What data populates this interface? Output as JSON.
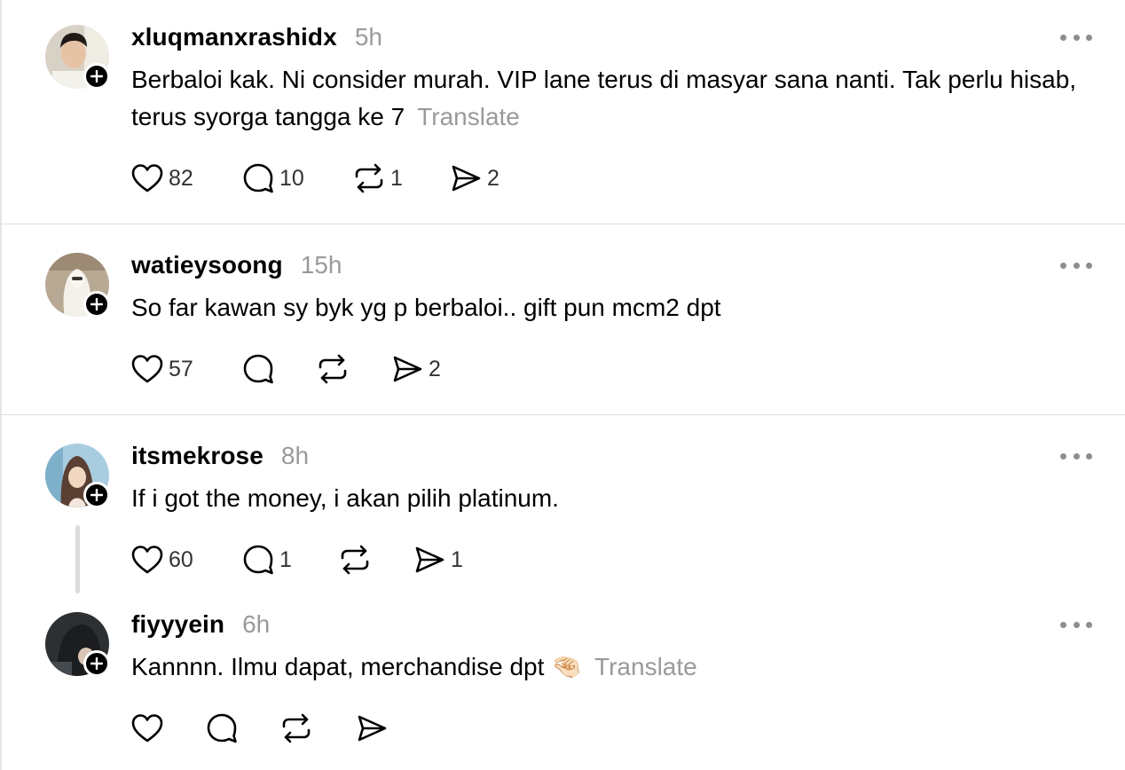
{
  "replies": [
    {
      "username": "xluqmanxrashidx",
      "time": "5h",
      "text": "Berbaloi kak. Ni consider murah. VIP lane terus di masyar sana nanti. Tak perlu hisab, terus syorga tangga ke 7",
      "translate": "Translate",
      "likes": "82",
      "comments": "10",
      "reposts": "1",
      "shares": "2"
    },
    {
      "username": "watieysoong",
      "time": "15h",
      "text": "So far kawan sy byk yg p berbaloi.. gift pun mcm2 dpt",
      "likes": "57",
      "shares": "2"
    },
    {
      "username": "itsmekrose",
      "time": "8h",
      "text": "If i got the money, i akan pilih platinum.",
      "likes": "60",
      "comments": "1",
      "shares": "1"
    },
    {
      "username": "fiyyyein",
      "time": "6h",
      "text": "Kannnn. Ilmu dapat, merchandise dpt 🤏🏻",
      "translate": "Translate"
    }
  ]
}
